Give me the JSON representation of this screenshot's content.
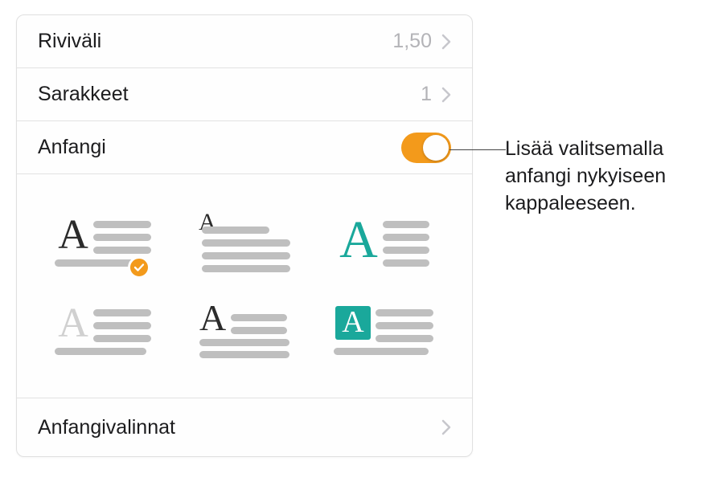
{
  "rows": {
    "line_spacing": {
      "label": "Riviväli",
      "value": "1,50"
    },
    "columns": {
      "label": "Sarakkeet",
      "value": "1"
    },
    "dropcap": {
      "label": "Anfangi",
      "on": true
    }
  },
  "style_options": [
    {
      "id": "style-1",
      "selected": true
    },
    {
      "id": "style-2",
      "selected": false
    },
    {
      "id": "style-3",
      "selected": false
    },
    {
      "id": "style-4",
      "selected": false
    },
    {
      "id": "style-5",
      "selected": false
    },
    {
      "id": "style-6",
      "selected": false
    }
  ],
  "options_row": {
    "label": "Anfangivalinnat"
  },
  "callout": {
    "text": "Lisää valitsemalla anfangi nykyiseen kappaleeseen."
  }
}
